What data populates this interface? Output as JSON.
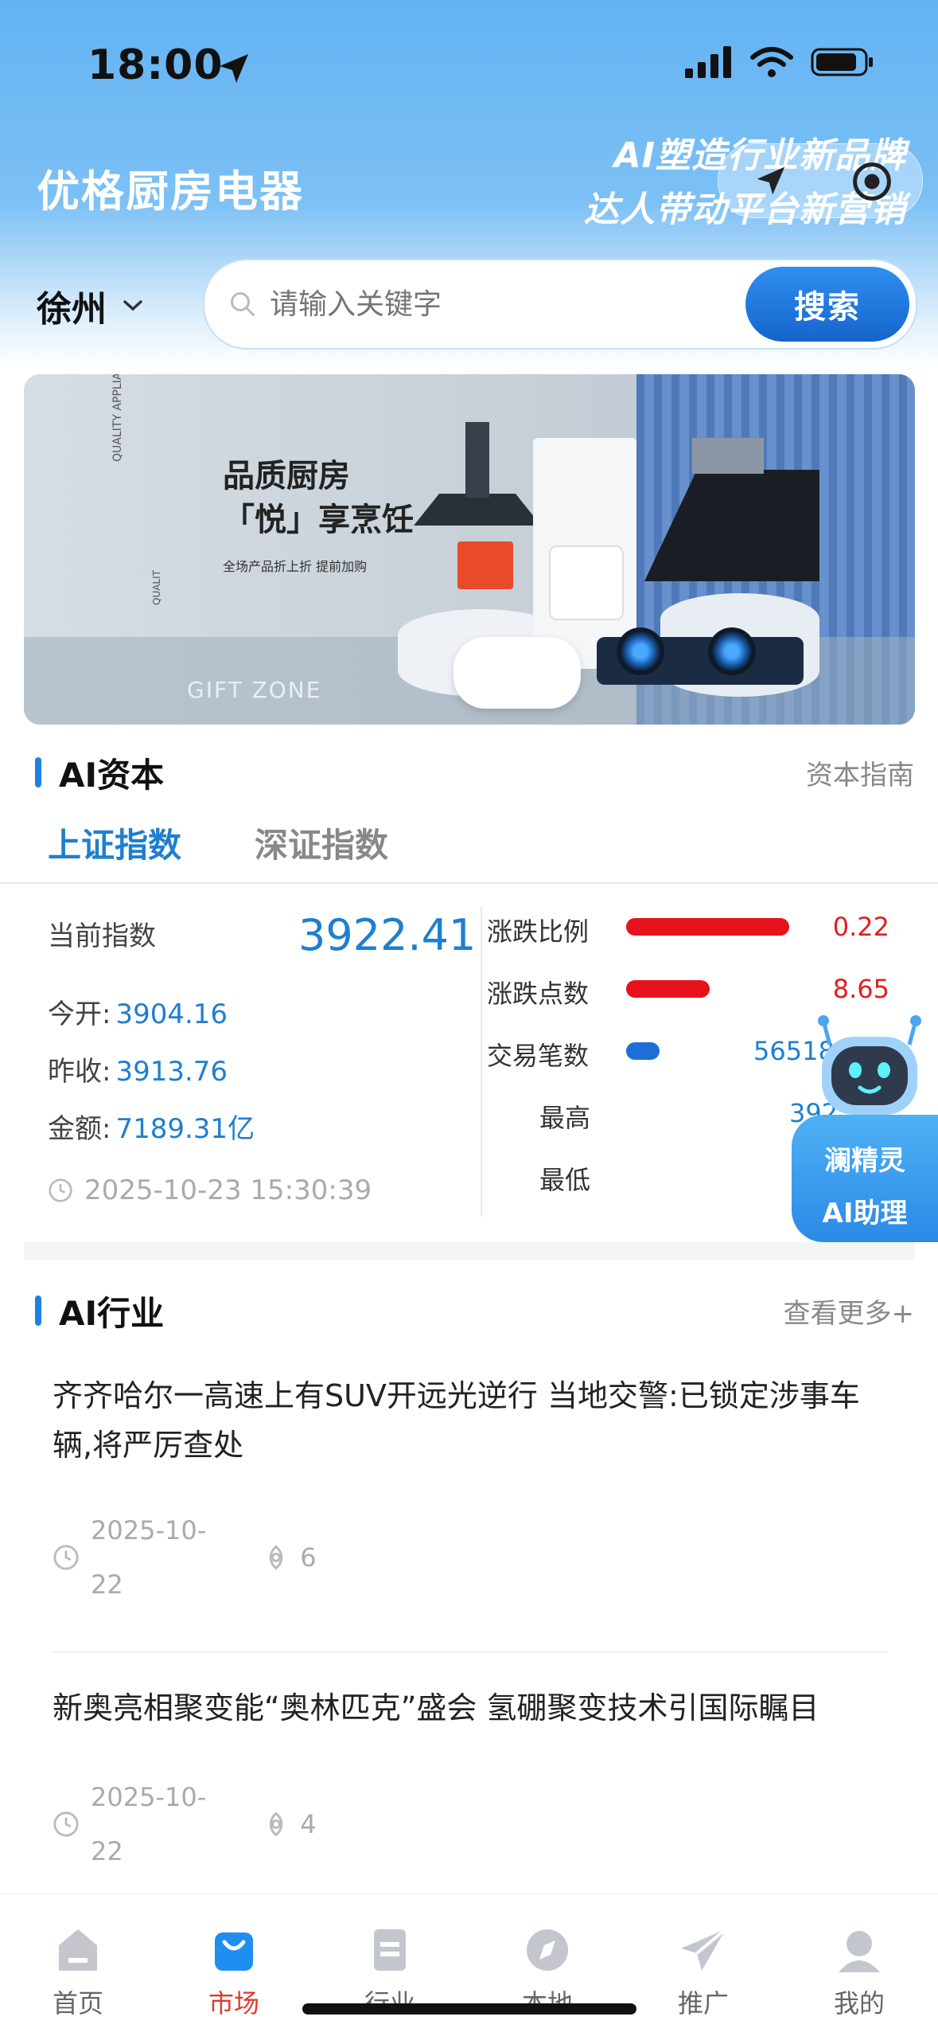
{
  "status_bar": {
    "time": "18:00"
  },
  "header": {
    "app_title": "优格厨房电器",
    "slogan_line1": "AI塑造行业新品牌",
    "slogan_line2": "达人带动平台新营销",
    "city": "徐州",
    "search_placeholder": "请输入关键字",
    "search_button": "搜索"
  },
  "banner": {
    "headline_line1": "品质厨房",
    "headline_line2": "「悦」享烹饪",
    "subline": "全场产品折上折  提前加购",
    "side_text": "QUALITY APPLIANCES",
    "side_text2": "QUALIT",
    "footer_text": "GIFT ZONE"
  },
  "capital": {
    "title": "AI资本",
    "link": "资本指南",
    "tabs": [
      {
        "label": "上证指数",
        "active": true
      },
      {
        "label": "深证指数",
        "active": false
      }
    ],
    "current_label": "当前指数",
    "current_value": "3922.41",
    "open_label": "今开:",
    "open_value": "3904.16",
    "prev_label": "昨收:",
    "prev_value": "3913.76",
    "amount_label": "金额:",
    "amount_value": "7189.31亿",
    "timestamp": "2025-10-23 15:30:39",
    "right_rows": [
      {
        "label": "涨跌比例",
        "value": "0.22",
        "bar_fraction": 0.78,
        "bar_color": "#e8121c"
      },
      {
        "label": "涨跌点数",
        "value": "8.65",
        "bar_fraction": 0.4,
        "bar_color": "#e8121c"
      },
      {
        "label": "交易笔数",
        "value": "56518",
        "bar_fraction": 0.16,
        "bar_color": "#1d6fd6"
      },
      {
        "label": "最高",
        "value": "392"
      },
      {
        "label": "最低",
        "value": ""
      }
    ]
  },
  "assistant": {
    "line1": "澜精灵",
    "line2": "AI助理"
  },
  "industry": {
    "title": "AI行业",
    "link": "查看更多+",
    "news": [
      {
        "title": "齐齐哈尔一高速上有SUV开远光逆行 当地交警:已锁定涉事车辆,将严厉查处",
        "date_line1": "2025-10-",
        "date_line2": "22",
        "views": "6"
      },
      {
        "title": "新奥亮相聚变能“奥林匹克”盛会 氢硼聚变技术引国际瞩目",
        "date_line1": "2025-10-",
        "date_line2": "22",
        "views": "4"
      }
    ]
  },
  "bottom_nav": [
    {
      "label": "首页",
      "icon": "home-icon",
      "active": false
    },
    {
      "label": "市场",
      "icon": "shopping-bag-icon",
      "active": true
    },
    {
      "label": "行业",
      "icon": "document-icon",
      "active": false
    },
    {
      "label": "本地",
      "icon": "compass-icon",
      "active": false
    },
    {
      "label": "推广",
      "icon": "paper-plane-icon",
      "active": false
    },
    {
      "label": "我的",
      "icon": "user-icon",
      "active": false
    }
  ],
  "colors": {
    "accent": "#1d82e0",
    "nav_active": "#e03a2e",
    "down_red": "#e8121c"
  }
}
